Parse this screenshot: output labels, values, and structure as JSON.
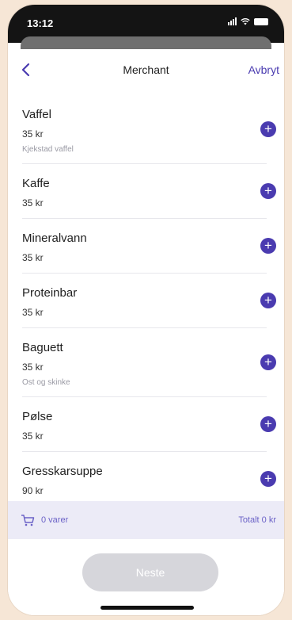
{
  "status": {
    "time": "13:12"
  },
  "nav": {
    "title": "Merchant",
    "cancel_label": "Avbryt"
  },
  "items": [
    {
      "name": "Vaffel",
      "price": "35 kr",
      "note": "Kjekstad vaffel"
    },
    {
      "name": "Kaffe",
      "price": "35 kr",
      "note": ""
    },
    {
      "name": "Mineralvann",
      "price": "35 kr",
      "note": ""
    },
    {
      "name": "Proteinbar",
      "price": "35 kr",
      "note": ""
    },
    {
      "name": "Baguett",
      "price": "35 kr",
      "note": "Ost og skinke"
    },
    {
      "name": "Pølse",
      "price": "35 kr",
      "note": ""
    },
    {
      "name": "Gresskarsuppe",
      "price": "90 kr",
      "note": ""
    }
  ],
  "cart": {
    "count_label": "0 varer",
    "total_label": "Totalt 0 kr"
  },
  "footer": {
    "next_label": "Neste"
  },
  "colors": {
    "accent": "#4a3bb0",
    "disabled": "#d6d6db",
    "background": "#f6e6d6"
  }
}
